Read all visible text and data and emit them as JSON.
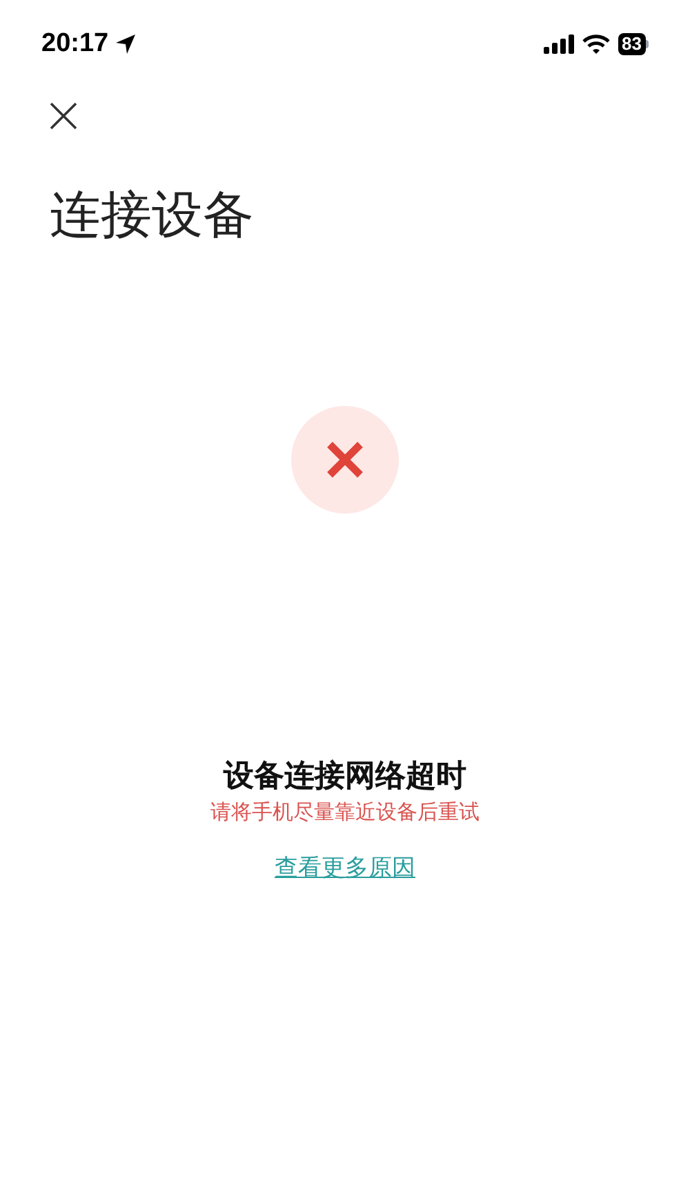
{
  "status_bar": {
    "time": "20:17",
    "battery": "83"
  },
  "title": "连接设备",
  "error": {
    "heading": "设备连接网络超时",
    "hint": "请将手机尽量靠近设备后重试",
    "link": "查看更多原因"
  }
}
